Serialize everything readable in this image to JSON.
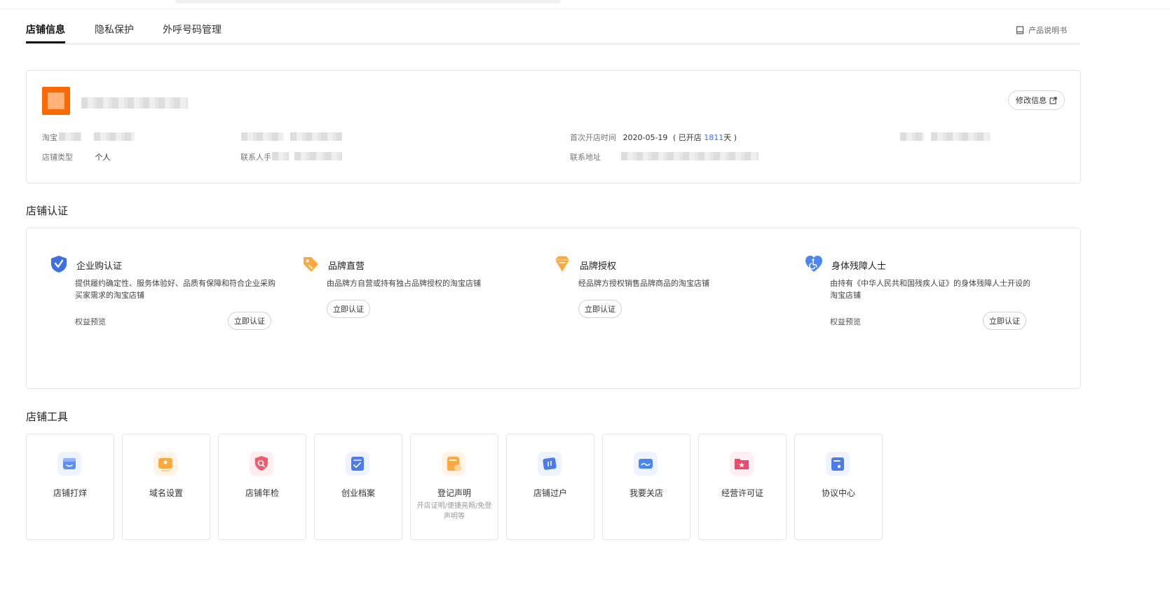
{
  "tabs": [
    "店铺信息",
    "隐私保护",
    "外呼号码管理"
  ],
  "product_manual": "产品说明书",
  "store_info": {
    "edit_button": "修改信息",
    "taobao_label": "淘宝",
    "first_open_label": "首次开店时间",
    "first_open_date": "2020-05-19",
    "opened_prefix": "( 已开店",
    "opened_days": "1811",
    "opened_suffix": "天 )",
    "store_type_label": "店铺类型",
    "store_type_value": "个人",
    "contact_phone_label": "联系人手",
    "contact_address_label": "联系地址"
  },
  "certification": {
    "title": "店铺认证",
    "items": [
      {
        "title": "企业购认证",
        "desc": "提供履约确定性、服务体验好、品质有保障和符合企业采购买家需求的淘宝店铺",
        "rights": "权益预览",
        "button": "立即认证",
        "color": "#3d6fe6",
        "icon": "shield-check-icon"
      },
      {
        "title": "品牌直营",
        "desc": "由品牌方自营或持有独占品牌授权的淘宝店铺",
        "rights": "",
        "button": "立即认证",
        "color": "#ff9a2e",
        "icon": "tag-icon"
      },
      {
        "title": "品牌授权",
        "desc": "经品牌方授权销售品牌商品的淘宝店铺",
        "rights": "",
        "button": "立即认证",
        "color": "#ff9a2e",
        "icon": "diamond-icon"
      },
      {
        "title": "身体残障人士",
        "desc": "由持有《中华人民共和国残疾人证》的身体残障人士开设的淘宝店铺",
        "rights": "权益预览",
        "button": "立即认证",
        "color": "#4a86f5",
        "icon": "heart-accessibility-icon"
      }
    ]
  },
  "tools": {
    "title": "店铺工具",
    "items": [
      {
        "label": "店铺打烊",
        "sub": "",
        "color": "#5b8ff9",
        "icon": "shop-closed-icon"
      },
      {
        "label": "域名设置",
        "sub": "",
        "color": "#ff9a2e",
        "icon": "domain-icon"
      },
      {
        "label": "店铺年检",
        "sub": "",
        "color": "#f25a6e",
        "icon": "inspection-icon"
      },
      {
        "label": "创业档案",
        "sub": "",
        "color": "#4a7bf0",
        "icon": "archive-icon"
      },
      {
        "label": "登记声明",
        "sub": "开店证明/便捷亮照/免登声明等",
        "color": "#ff9a2e",
        "icon": "register-icon"
      },
      {
        "label": "店铺过户",
        "sub": "",
        "color": "#4a7bf0",
        "icon": "transfer-icon"
      },
      {
        "label": "我要关店",
        "sub": "",
        "color": "#4a86f5",
        "icon": "close-store-icon"
      },
      {
        "label": "经营许可证",
        "sub": "",
        "color": "#f04a6b",
        "icon": "license-icon"
      },
      {
        "label": "协议中心",
        "sub": "",
        "color": "#4a7bf0",
        "icon": "agreement-icon"
      }
    ]
  }
}
